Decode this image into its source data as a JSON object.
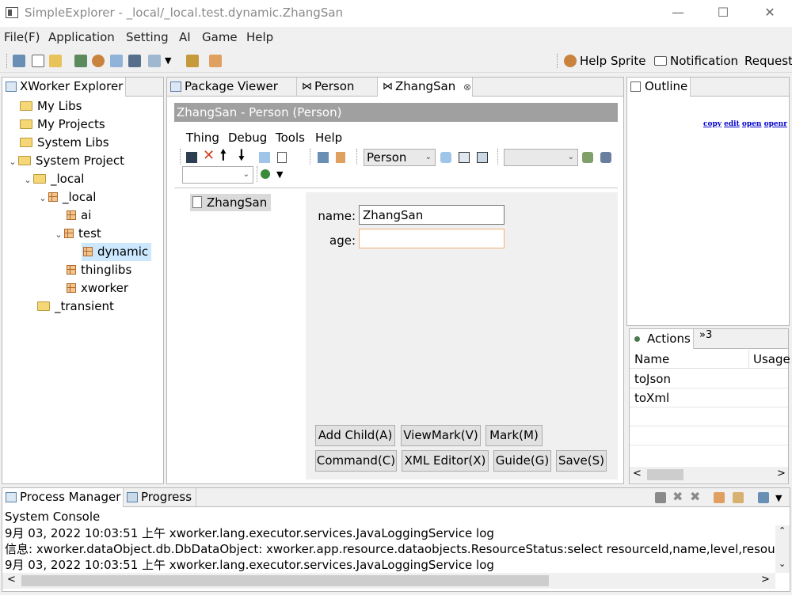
{
  "window": {
    "title": "SimpleExplorer - _local/_local.test.dynamic.ZhangSan"
  },
  "menubar": [
    "File(F)",
    "Application",
    "Setting",
    "AI",
    "Game",
    "Help"
  ],
  "toolbar_right": {
    "help_sprite": "Help Sprite",
    "notification": "Notification",
    "request": "Request"
  },
  "explorer": {
    "tab_label": "XWorker Explorer",
    "tree": [
      {
        "label": "My Libs",
        "icon": "folder-icon",
        "level": 1
      },
      {
        "label": "My Projects",
        "icon": "folder-icon",
        "level": 1
      },
      {
        "label": "System Libs",
        "icon": "folder-icon",
        "level": 1
      },
      {
        "label": "System Project",
        "icon": "folder-icon",
        "level": 1,
        "expanded": true
      },
      {
        "label": "_local",
        "icon": "folder-open-icon",
        "level": 2,
        "expanded": true
      },
      {
        "label": "_local",
        "icon": "package-icon",
        "level": 3,
        "expanded": true
      },
      {
        "label": "ai",
        "icon": "package-icon",
        "level": 4
      },
      {
        "label": "test",
        "icon": "package-icon",
        "level": 4,
        "expanded": true
      },
      {
        "label": "dynamic",
        "icon": "package-icon",
        "level": 5,
        "selected": true
      },
      {
        "label": "thinglibs",
        "icon": "package-icon",
        "level": 4
      },
      {
        "label": "xworker",
        "icon": "package-icon",
        "level": 4
      },
      {
        "label": "_transient",
        "icon": "folder-open-icon",
        "level": 2
      }
    ]
  },
  "editor": {
    "tabs": [
      {
        "label": "Package Viewer",
        "active": false
      },
      {
        "label": "Person",
        "active": false
      },
      {
        "label": "ZhangSan",
        "active": true
      }
    ],
    "header": "ZhangSan - Person  (Person)",
    "menu": [
      "Thing",
      "Debug",
      "Tools",
      "Help"
    ],
    "type_combo": "Person",
    "tree_node": "ZhangSan",
    "form": {
      "name_label": "name:",
      "name_value": "ZhangSan",
      "age_label": "age:",
      "age_value": ""
    },
    "buttons_row1": [
      "Add Child(A)",
      "ViewMark(V)",
      "Mark(M)"
    ],
    "buttons_row2": [
      "Command(C)",
      "XML Editor(X)",
      "Guide(G)",
      "Save(S)"
    ]
  },
  "outline": {
    "tab_label": "Outline",
    "links": [
      "copy",
      "edit",
      "open",
      "openr"
    ]
  },
  "actions": {
    "tab_label": "Actions",
    "overflow": "»3",
    "columns": [
      "Name",
      "Usage"
    ],
    "rows": [
      "toJson",
      "toXml"
    ]
  },
  "bottom": {
    "tabs": [
      "Process Manager",
      "Progress"
    ],
    "console_title": "System Console",
    "lines": [
      "9月 03, 2022 10:03:51 上午 xworker.lang.executor.services.JavaLoggingService log",
      "信息: xworker.dataObject.db.DbDataObject: xworker.app.resource.dataobjects.ResourceStatus:select resourceId,name,level,resourceI",
      "9月 03, 2022 10:03:51 上午 xworker.lang.executor.services.JavaLoggingService log"
    ]
  },
  "colors": {
    "selection": "#cce8ff",
    "header_bar": "#a0a0a0",
    "link": "#0000cc",
    "input_focus": "#f0b27a"
  }
}
